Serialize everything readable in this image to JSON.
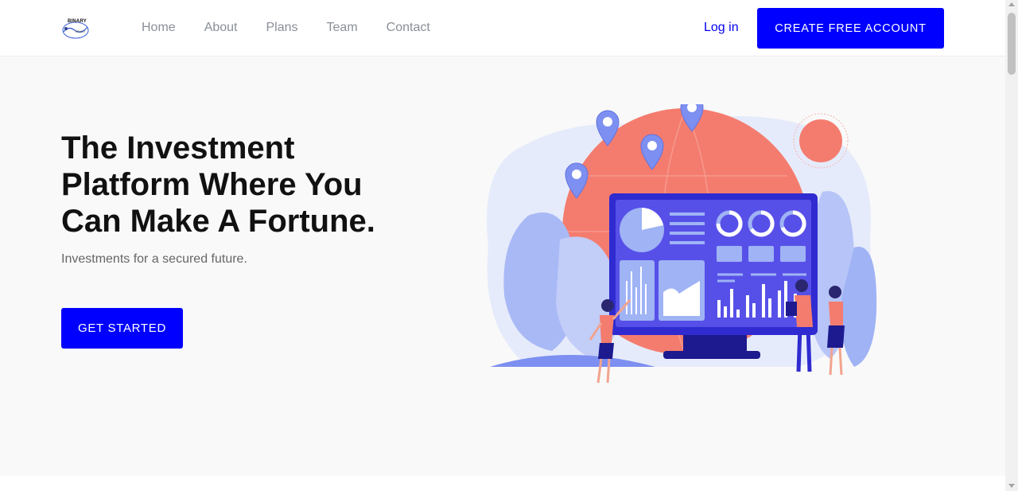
{
  "header": {
    "logo_text": "BINARY",
    "logo_subtext": "TRUST",
    "nav": [
      "Home",
      "About",
      "Plans",
      "Team",
      "Contact"
    ],
    "login_label": "Log in",
    "create_account_label": "CREATE FREE ACCOUNT"
  },
  "hero": {
    "title": "The Investment Platform Where You Can Make A Fortune.",
    "subtitle": "Investments for a secured future.",
    "cta_label": "GET STARTED",
    "illustration": "investment-dashboard-illustration"
  },
  "colors": {
    "accent": "#0000ff",
    "hero_bg": "#f9f9f9",
    "globe": "#f47c6e",
    "monitor": "#2f2bd0",
    "foliage": "#9fb3f5"
  }
}
